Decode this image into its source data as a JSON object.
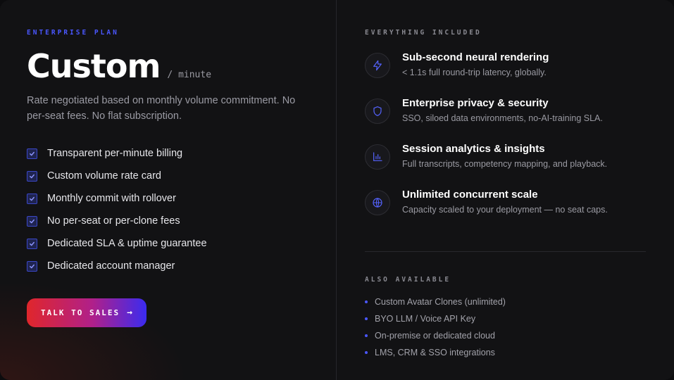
{
  "plan": {
    "eyebrow": "ENTERPRISE PLAN",
    "price": "Custom",
    "unit": "/ minute",
    "description": "Rate negotiated based on monthly volume commitment. No per-seat fees. No flat subscription.",
    "features": [
      "Transparent per-minute billing",
      "Custom volume rate card",
      "Monthly commit with rollover",
      "No per-seat or per-clone fees",
      "Dedicated SLA & uptime guarantee",
      "Dedicated account manager"
    ],
    "cta_label": "TALK TO SALES",
    "cta_arrow": "→"
  },
  "included": {
    "eyebrow": "EVERYTHING INCLUDED",
    "items": [
      {
        "icon": "lightning-icon",
        "title": "Sub-second neural rendering",
        "subtitle": "< 1.1s full round-trip latency, globally."
      },
      {
        "icon": "shield-icon",
        "title": "Enterprise privacy & security",
        "subtitle": "SSO, siloed data environments, no-AI-training SLA."
      },
      {
        "icon": "bar-chart-icon",
        "title": "Session analytics & insights",
        "subtitle": "Full transcripts, competency mapping, and playback."
      },
      {
        "icon": "globe-icon",
        "title": "Unlimited concurrent scale",
        "subtitle": "Capacity scaled to your deployment — no seat caps."
      }
    ]
  },
  "also": {
    "eyebrow": "ALSO AVAILABLE",
    "items": [
      "Custom Avatar Clones (unlimited)",
      "BYO LLM / Voice API Key",
      "On-premise or dedicated cloud",
      "LMS, CRM & SSO integrations"
    ]
  },
  "colors": {
    "accent": "#4a57ff",
    "cta_gradient_start": "#e0262b",
    "cta_gradient_end": "#3b2bef",
    "background": "#121214"
  }
}
